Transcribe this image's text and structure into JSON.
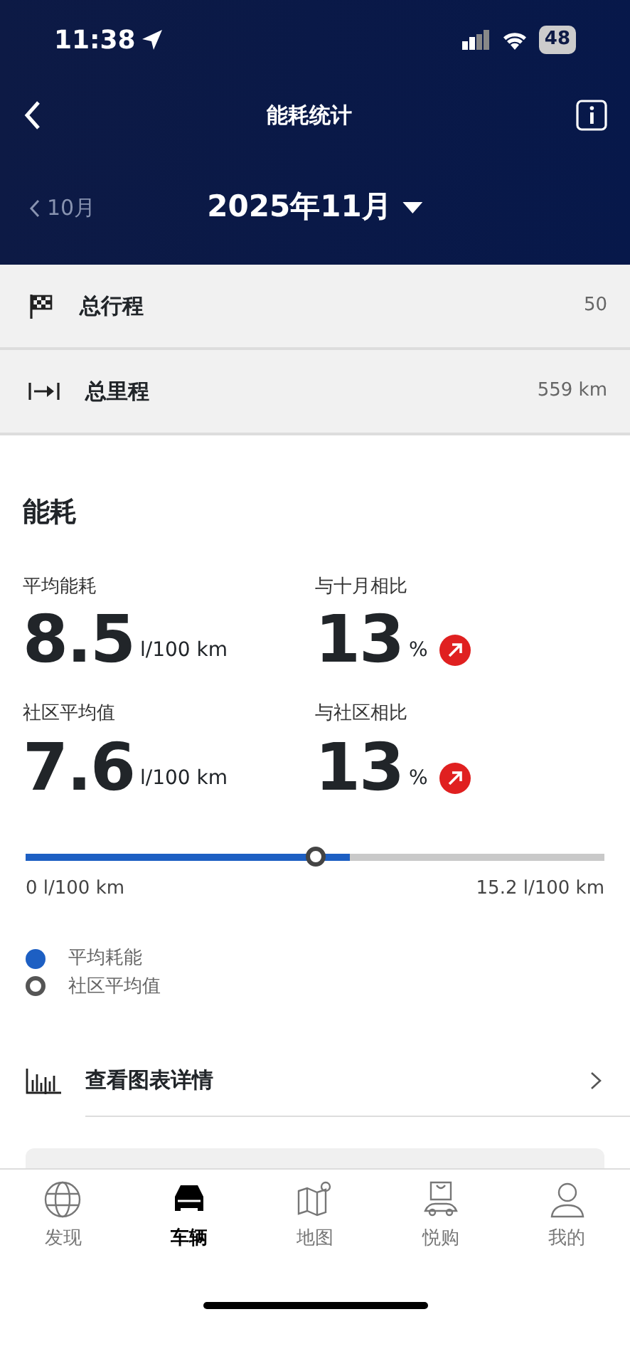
{
  "status_bar": {
    "time": "11:38",
    "battery": "48"
  },
  "header": {
    "title": "能耗统计",
    "prev_month": "10月",
    "month": "2025年11月"
  },
  "summary_rows": [
    {
      "kind": "flag",
      "label": "总行程",
      "value": "50"
    },
    {
      "kind": "distance",
      "label": "总里程",
      "value": "559 km"
    }
  ],
  "consumption": {
    "title": "能耗",
    "stats": [
      {
        "kind": "plain",
        "label": "平均能耗",
        "value": "8.5",
        "unit": "l/100 km"
      },
      {
        "kind": "trend_up",
        "label": "与十月相比",
        "value": "13",
        "unit": "%"
      },
      {
        "kind": "plain",
        "label": "社区平均值",
        "value": "7.6",
        "unit": "l/100 km"
      },
      {
        "kind": "trend_up",
        "label": "与社区相比",
        "value": "13",
        "unit": "%"
      }
    ],
    "scale": {
      "average": {
        "level": 0.559
      },
      "community": {
        "level": 0.5
      },
      "min_label": "0 l/100 km",
      "max_label": "15.2 l/100 km"
    },
    "legend": [
      {
        "kind": "filled",
        "label": "平均耗能"
      },
      {
        "kind": "ring",
        "label": "社区平均值"
      }
    ],
    "chart_link": "查看图表详情"
  },
  "tab_bar": [
    {
      "kind": "globe",
      "label": "发现",
      "selected": false
    },
    {
      "kind": "car",
      "label": "车辆",
      "selected": true
    },
    {
      "kind": "map",
      "label": "地图",
      "selected": false
    },
    {
      "kind": "shop",
      "label": "悦购",
      "selected": false
    },
    {
      "kind": "person",
      "label": "我的",
      "selected": false
    }
  ]
}
